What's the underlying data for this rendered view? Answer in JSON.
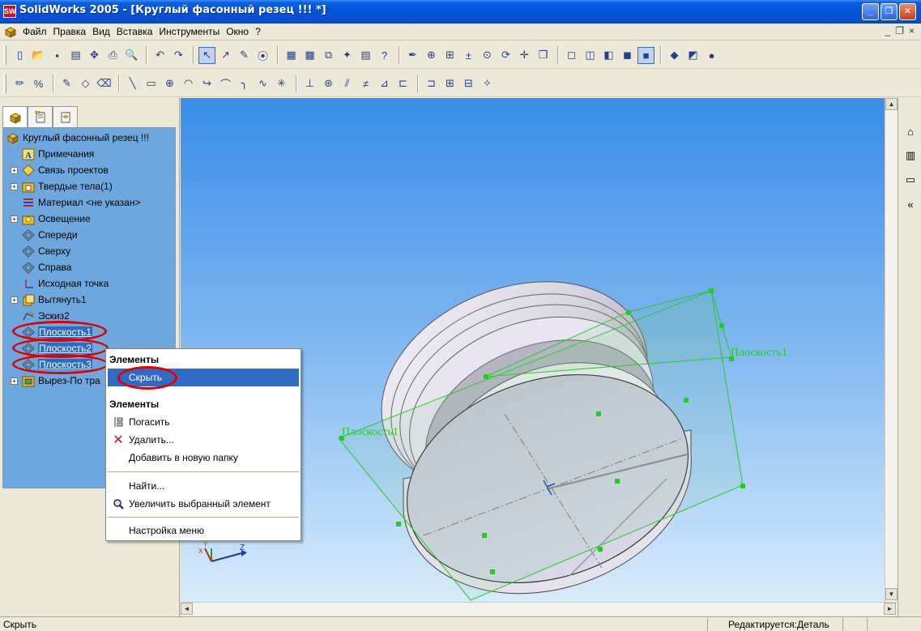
{
  "window": {
    "title": "SolidWorks 2005 - [Круглый фасонный резец !!! *]",
    "app_icon": "SW",
    "buttons": {
      "minimize": "_",
      "maximize": "❐",
      "close": "✕"
    }
  },
  "menu": {
    "items": [
      "Файл",
      "Правка",
      "Вид",
      "Вставка",
      "Инструменты",
      "Окно",
      "?"
    ],
    "mdi_buttons": {
      "minimize": "_",
      "restore": "❐",
      "close": "×"
    }
  },
  "toolbar1": {
    "icons": [
      "new-icon",
      "open-icon",
      "save-icon",
      "print-preview-icon",
      "options-icon",
      "print-icon",
      "preview-icon",
      "undo-icon",
      "redo-icon",
      "select-icon",
      "smart-select-icon",
      "sketch-icon",
      "traffic-light-icon",
      "grid-icon",
      "brick-icon",
      "view-orientation-icon",
      "magic-wand-icon",
      "properties-icon",
      "help-icon",
      "pen-icon",
      "zoom-fit-icon",
      "zoom-area-icon",
      "zoom-in-out-icon",
      "zoom-selection-icon",
      "rotate-icon",
      "pan-icon",
      "standard-views-icon",
      "wireframe-icon",
      "hidden-lines-icon",
      "hidden-removed-icon",
      "shaded-edges-icon",
      "shaded-icon",
      "perspective-icon",
      "section-icon",
      "render-icon"
    ]
  },
  "toolbar2": {
    "icons": [
      "sketch-mode-icon",
      "dimension-icon",
      "sketch-edit-icon",
      "smart-dim-icon",
      "eraser-icon",
      "line-icon",
      "rectangle-icon",
      "circle-icon",
      "arc-icon",
      "tangent-arc-icon",
      "centerpoint-arc-icon",
      "sketch-fillet-icon",
      "spline-icon",
      "point-icon",
      "centerline-icon",
      "offset-icon",
      "mirror-icon",
      "trim-icon",
      "relations-icon",
      "display-relations-icon",
      "mirror-sketch-icon",
      "linear-pattern-icon",
      "add-relation-icon",
      "repair-sketch-icon"
    ]
  },
  "panel_tabs": [
    "feature-manager-icon",
    "property-manager-icon",
    "configuration-manager-icon"
  ],
  "tree": {
    "items": [
      {
        "label": "Круглый фасонный резец !!!",
        "icon": "part-icon",
        "expander": "",
        "highlight": false,
        "root": true
      },
      {
        "label": "Примечания",
        "icon": "annotations-icon",
        "expander": "",
        "highlight": false
      },
      {
        "label": "Связь проектов",
        "icon": "design-link-icon",
        "expander": "+",
        "highlight": false
      },
      {
        "label": "Твердые тела(1)",
        "icon": "solid-bodies-icon",
        "expander": "+",
        "highlight": false
      },
      {
        "label": "Материал <не указан>",
        "icon": "material-icon",
        "expander": "",
        "highlight": false
      },
      {
        "label": "Освещение",
        "icon": "lighting-icon",
        "expander": "+",
        "highlight": false
      },
      {
        "label": "Спереди",
        "icon": "plane-icon",
        "expander": "",
        "highlight": false
      },
      {
        "label": "Сверху",
        "icon": "plane-icon",
        "expander": "",
        "highlight": false
      },
      {
        "label": "Справа",
        "icon": "plane-icon",
        "expander": "",
        "highlight": false
      },
      {
        "label": "Исходная точка",
        "icon": "origin-icon",
        "expander": "",
        "highlight": false
      },
      {
        "label": "Вытянуть1",
        "icon": "extrude-icon",
        "expander": "+",
        "highlight": false
      },
      {
        "label": "Эскиз2",
        "icon": "sketch-icon",
        "expander": "",
        "highlight": false
      },
      {
        "label": "Плоскость1",
        "icon": "plane-icon",
        "expander": "",
        "highlight": true
      },
      {
        "label": "Плоскость2",
        "icon": "plane-icon",
        "expander": "",
        "highlight": true
      },
      {
        "label": "Плоскость3",
        "icon": "plane-icon",
        "expander": "",
        "highlight": true
      },
      {
        "label": "Вырез-По тра",
        "icon": "cut-sweep-icon",
        "expander": "+",
        "highlight": false
      }
    ]
  },
  "context_menu": {
    "header1": "Элементы",
    "hide": "Скрыть",
    "header2": "Элементы",
    "suppress": "Погасить",
    "delete": "Удалить...",
    "add_folder": "Добавить в новую папку",
    "find": "Найти...",
    "zoom_selected": "Увеличить выбранный элемент",
    "customize": "Настройка меню"
  },
  "viewport": {
    "plane_label_1": "Плоскость1",
    "plane_label_2": "Плоскость1",
    "triad_z": "Z",
    "triad_x": "X",
    "triad_y": "Y",
    "accent_plane": "#22cc22",
    "background_top": "#3a8de8",
    "background_bottom": "#d8ebfb"
  },
  "statusbar": {
    "left": "Скрыть",
    "right": "Редактируется:Деталь"
  },
  "colors": {
    "highlight": "#316ac5",
    "annotation_ring": "#e00000",
    "tree_background": "#6ea7de"
  }
}
